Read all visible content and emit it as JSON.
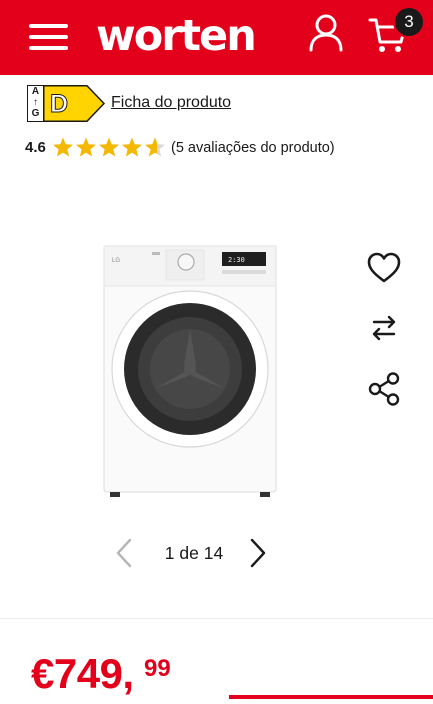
{
  "header": {
    "logo": "worten",
    "cart_count": "3"
  },
  "energy": {
    "scale_top": "A",
    "scale_bottom": "G",
    "class": "D",
    "product_sheet_link": "Ficha do produto"
  },
  "rating": {
    "value": "4.6",
    "stars": 4.6,
    "max_stars": 5,
    "count_text": "(5 avaliações do produto)"
  },
  "gallery": {
    "current": 1,
    "total": 14,
    "pager_text": "1 de 14",
    "product_panel_brand": "LG",
    "display_readout": "2:30"
  },
  "price": {
    "main": "€749,",
    "cents": "99"
  },
  "colors": {
    "brand": "#e3001b",
    "energy_d": "#ffd400",
    "star": "#f5b800"
  },
  "icons": {
    "menu": "hamburger-menu-icon",
    "user": "user-icon",
    "cart": "cart-icon",
    "favorite": "heart-icon",
    "compare": "compare-arrows-icon",
    "share": "share-icon",
    "prev": "chevron-left-icon",
    "next": "chevron-right-icon"
  }
}
